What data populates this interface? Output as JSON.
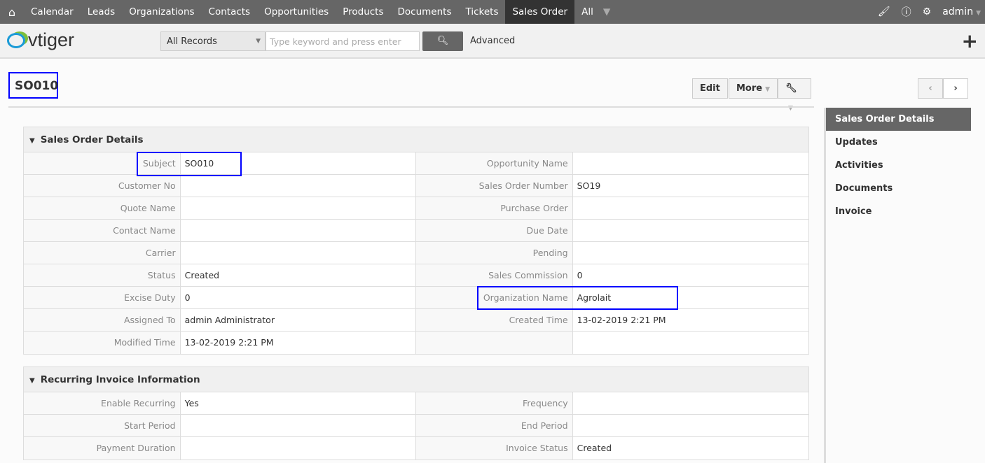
{
  "topbar": {
    "nav": [
      "Calendar",
      "Leads",
      "Organizations",
      "Contacts",
      "Opportunities",
      "Products",
      "Documents",
      "Tickets",
      "Sales Order",
      "All"
    ],
    "active": "Sales Order",
    "user": "admin"
  },
  "header": {
    "logo": "vtiger",
    "scope": "All Records",
    "search_placeholder": "Type keyword and press enter",
    "advanced": "Advanced"
  },
  "record": {
    "title": "SO010",
    "edit": "Edit",
    "more": "More"
  },
  "blocks": [
    {
      "title": "Sales Order Details",
      "rows": [
        [
          "Subject",
          "SO010",
          "Opportunity Name",
          ""
        ],
        [
          "Customer No",
          "",
          "Sales Order Number",
          "SO19"
        ],
        [
          "Quote Name",
          "",
          "Purchase Order",
          ""
        ],
        [
          "Contact Name",
          "",
          "Due Date",
          ""
        ],
        [
          "Carrier",
          "",
          "Pending",
          ""
        ],
        [
          "Status",
          "Created",
          "Sales Commission",
          "0"
        ],
        [
          "Excise Duty",
          "0",
          "Organization Name",
          "Agrolait"
        ],
        [
          "Assigned To",
          "admin Administrator",
          "Created Time",
          "13-02-2019 2:21 PM"
        ],
        [
          "Modified Time",
          "13-02-2019 2:21 PM",
          "",
          ""
        ]
      ]
    },
    {
      "title": "Recurring Invoice Information",
      "rows": [
        [
          "Enable Recurring",
          "Yes",
          "Frequency",
          ""
        ],
        [
          "Start Period",
          "",
          "End Period",
          ""
        ],
        [
          "Payment Duration",
          "",
          "Invoice Status",
          "Created"
        ]
      ]
    }
  ],
  "sidebar": {
    "items": [
      "Sales Order Details",
      "Updates",
      "Activities",
      "Documents",
      "Invoice"
    ],
    "active": 0
  }
}
